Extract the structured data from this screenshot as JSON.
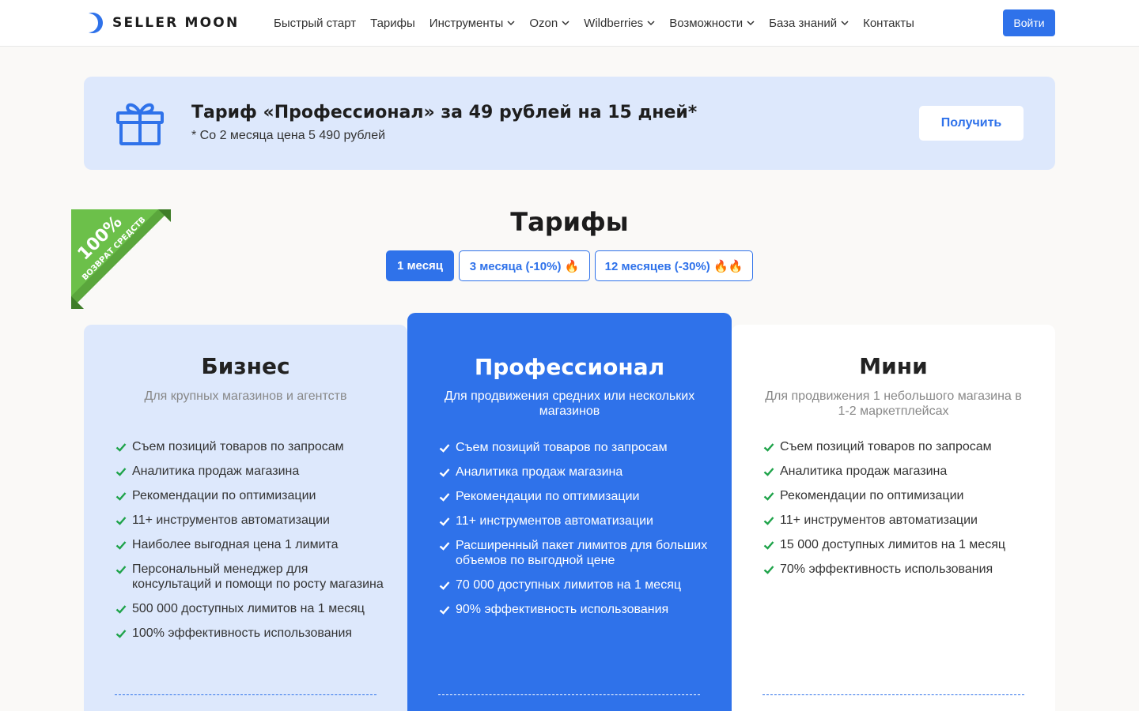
{
  "header": {
    "logo_text": "SELLER MOON",
    "nav": [
      {
        "label": "Быстрый старт",
        "dropdown": false
      },
      {
        "label": "Тарифы",
        "dropdown": false
      },
      {
        "label": "Инструменты",
        "dropdown": true
      },
      {
        "label": "Ozon",
        "dropdown": true
      },
      {
        "label": "Wildberries",
        "dropdown": true
      },
      {
        "label": "Возможности",
        "dropdown": true
      },
      {
        "label": "База знаний",
        "dropdown": true
      },
      {
        "label": "Контакты",
        "dropdown": false
      }
    ],
    "login_label": "Войти"
  },
  "promo": {
    "title": "Тариф «Профессионал» за 49 рублей на 15 дней*",
    "subtitle": "* Со 2 месяца цена 5 490 рублей",
    "button_label": "Получить",
    "icon": "gift-icon"
  },
  "ribbon": {
    "big": "100%",
    "small": "ВОЗВРАТ СРЕДСТВ"
  },
  "tariffs": {
    "title": "Тарифы",
    "tabs": [
      {
        "label": "1 месяц",
        "active": true
      },
      {
        "label": "3 месяца (-10%) 🔥",
        "active": false
      },
      {
        "label": "12 месяцев (-30%) 🔥🔥",
        "active": false
      }
    ]
  },
  "plans": [
    {
      "name": "Бизнес",
      "description": "Для крупных магазинов и агентств",
      "features": [
        "Съем позиций товаров по запросам",
        "Аналитика продаж магазина",
        "Рекомендации по оптимизации",
        "11+ инструментов автоматизации",
        "Наиболее выгодная цена 1 лимита",
        "Персональный менеджер для консультаций и помощи по росту магазина",
        "500 000 доступных лимитов на 1 месяц",
        "100% эффективность использования"
      ]
    },
    {
      "name": "Профессионал",
      "description": "Для продвижения средних или нескольких магазинов",
      "features": [
        "Съем позиций товаров по запросам",
        "Аналитика продаж магазина",
        "Рекомендации по оптимизации",
        "11+ инструментов автоматизации",
        "Расширенный пакет лимитов для больших объемов по выгодной цене",
        "70 000 доступных лимитов на 1 месяц",
        "90% эффективность использования"
      ]
    },
    {
      "name": "Мини",
      "description": "Для продвижения 1 небольшого магазина в 1-2 маркетплейсах",
      "features": [
        "Съем позиций товаров по запросам",
        "Аналитика продаж магазина",
        "Рекомендации по оптимизации",
        "11+ инструментов автоматизации",
        "15 000 доступных лимитов на 1 месяц",
        "70% эффективность использования"
      ]
    }
  ],
  "colors": {
    "accent": "#2f72ea",
    "check_green": "#1fa34a",
    "promo_bg": "#dde8fc",
    "ribbon_green": "#6cc04a"
  }
}
